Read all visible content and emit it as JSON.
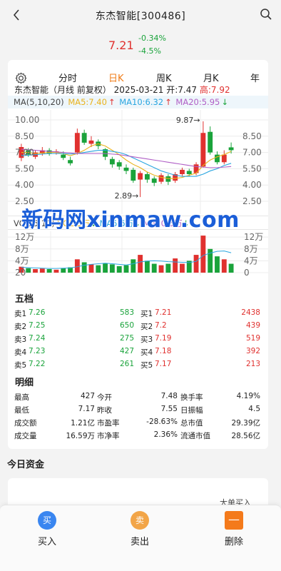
{
  "header": {
    "title": "东杰智能[300486]",
    "price": "7.21",
    "change_amount": "-0.34%",
    "change_percent": "-4.5%"
  },
  "tabs": [
    "分时",
    "日K",
    "周K",
    "月K",
    "年"
  ],
  "active_tab": "日K",
  "chart_info": {
    "name": "东杰智能",
    "mode": "（月线 前复权）",
    "date": "2025-03-21",
    "open": "开:7.47",
    "high": "高:7.92"
  },
  "ma_legend": {
    "label": "MA(5,10,20)",
    "ma5": "MA5:7.40",
    "ma10": "MA10:6.32",
    "ma20": "MA20:5.95",
    "ma5_arrow": "↑",
    "ma10_arrow": "↑",
    "ma20_arrow": "↓"
  },
  "chart_axis": {
    "left_ticks": [
      "10.00",
      "8.50",
      "7.00",
      "5.50",
      "4.00",
      "2.50"
    ],
    "right_ticks": [
      "8.50",
      "7.00",
      "5.50",
      "4.00",
      "2.50"
    ],
    "max_label": "9.87→",
    "min_label": "2.89→"
  },
  "vol_legend": {
    "label": "VOL(5,10)",
    "vol": "VOL:3万",
    "ma5": "MA5:5万",
    "ma10": "MA10:5万",
    "vol_arrow": "↓",
    "ma5_arrow": "↓",
    "ma10_arrow": "↓"
  },
  "vol_axis": {
    "left_ticks": [
      "12万",
      "8万",
      "4万",
      "20"
    ],
    "right_ticks": [
      "12万",
      "8万",
      "4万",
      "0"
    ],
    "date_label": "20"
  },
  "watermark": "新码网xinmaw.com",
  "order_book": {
    "title": "五档",
    "sell": [
      {
        "label": "卖1",
        "price": "7.26",
        "vol": "583"
      },
      {
        "label": "卖2",
        "price": "7.25",
        "vol": "650"
      },
      {
        "label": "卖3",
        "price": "7.24",
        "vol": "275"
      },
      {
        "label": "卖4",
        "price": "7.23",
        "vol": "427"
      },
      {
        "label": "卖5",
        "price": "7.22",
        "vol": "261"
      }
    ],
    "buy": [
      {
        "label": "买1",
        "price": "7.21",
        "vol": "2438"
      },
      {
        "label": "买2",
        "price": "7.2",
        "vol": "439"
      },
      {
        "label": "买3",
        "price": "7.19",
        "vol": "519"
      },
      {
        "label": "买4",
        "price": "7.18",
        "vol": "392"
      },
      {
        "label": "买5",
        "price": "7.17",
        "vol": "213"
      }
    ]
  },
  "detail": {
    "title": "明细",
    "rows": [
      [
        "最高",
        "427",
        "今开",
        "7.48",
        "换手率",
        "4.19%"
      ],
      [
        "最低",
        "7.17",
        "昨收",
        "7.55",
        "日振幅",
        "4.5"
      ],
      [
        "成交额",
        "1.21亿",
        "市盈率",
        "-28.63%",
        "总市值",
        "29.39亿"
      ],
      [
        "成交量",
        "16.59万",
        "市净率",
        "2.36%",
        "流通市值",
        "28.56亿"
      ]
    ]
  },
  "funds": {
    "title": "今日资金",
    "label": "大单买入"
  },
  "actions": {
    "buy": {
      "icon": "买",
      "label": "买入"
    },
    "sell": {
      "icon": "卖",
      "label": "卖出"
    },
    "delete": {
      "label": "删除"
    }
  },
  "colors": {
    "up": "#e0312f",
    "down": "#1aa33b",
    "ma5": "#e9b21b",
    "ma10": "#2aa6e0",
    "ma20": "#b05fc6",
    "accent": "#f07d1a"
  },
  "chart_data": {
    "type": "candlestick",
    "y_range": [
      2.5,
      10.0
    ],
    "candles": [
      {
        "o": 6.5,
        "c": 7.5,
        "h": 7.8,
        "l": 6.2
      },
      {
        "o": 7.2,
        "c": 6.8,
        "h": 7.4,
        "l": 6.6
      },
      {
        "o": 6.6,
        "c": 7.0,
        "h": 7.2,
        "l": 6.4
      },
      {
        "o": 6.9,
        "c": 7.2,
        "h": 7.5,
        "l": 6.7
      },
      {
        "o": 7.2,
        "c": 6.9,
        "h": 7.4,
        "l": 6.7
      },
      {
        "o": 7.0,
        "c": 7.1,
        "h": 7.3,
        "l": 6.8
      },
      {
        "o": 6.8,
        "c": 6.5,
        "h": 7.1,
        "l": 6.3
      },
      {
        "o": 6.3,
        "c": 6.0,
        "h": 6.6,
        "l": 5.8
      },
      {
        "o": 7.0,
        "c": 8.8,
        "h": 9.2,
        "l": 6.8
      },
      {
        "o": 8.8,
        "c": 7.9,
        "h": 9.1,
        "l": 7.7
      },
      {
        "o": 7.8,
        "c": 8.1,
        "h": 8.5,
        "l": 7.5
      },
      {
        "o": 8.0,
        "c": 7.6,
        "h": 8.2,
        "l": 7.3
      },
      {
        "o": 7.3,
        "c": 6.6,
        "h": 7.4,
        "l": 6.3
      },
      {
        "o": 6.4,
        "c": 5.9,
        "h": 6.6,
        "l": 5.6
      },
      {
        "o": 6.1,
        "c": 5.7,
        "h": 6.3,
        "l": 5.4
      },
      {
        "o": 5.6,
        "c": 5.3,
        "h": 5.9,
        "l": 5.0
      },
      {
        "o": 5.4,
        "c": 4.4,
        "h": 5.6,
        "l": 4.2
      },
      {
        "o": 4.5,
        "c": 5.1,
        "h": 5.3,
        "l": 2.89
      },
      {
        "o": 5.0,
        "c": 4.5,
        "h": 5.2,
        "l": 4.2
      },
      {
        "o": 4.6,
        "c": 4.2,
        "h": 4.8,
        "l": 3.9
      },
      {
        "o": 4.3,
        "c": 4.9,
        "h": 5.1,
        "l": 4.1
      },
      {
        "o": 4.8,
        "c": 4.3,
        "h": 5.0,
        "l": 4.0
      },
      {
        "o": 4.4,
        "c": 5.0,
        "h": 5.2,
        "l": 4.2
      },
      {
        "o": 5.0,
        "c": 5.4,
        "h": 5.6,
        "l": 4.8
      },
      {
        "o": 5.3,
        "c": 5.0,
        "h": 5.5,
        "l": 4.8
      },
      {
        "o": 5.1,
        "c": 5.9,
        "h": 6.1,
        "l": 4.9
      },
      {
        "o": 5.7,
        "c": 8.8,
        "h": 9.87,
        "l": 5.6
      },
      {
        "o": 8.9,
        "c": 7.0,
        "h": 9.4,
        "l": 6.8
      },
      {
        "o": 6.8,
        "c": 6.1,
        "h": 7.1,
        "l": 5.9
      },
      {
        "o": 6.1,
        "c": 6.8,
        "h": 7.2,
        "l": 5.9
      },
      {
        "o": 7.47,
        "c": 7.21,
        "h": 7.92,
        "l": 6.9
      }
    ],
    "ma5": [
      7.0,
      7.0,
      6.9,
      6.95,
      7.0,
      7.0,
      6.9,
      6.7,
      6.9,
      7.2,
      7.6,
      7.8,
      7.6,
      7.2,
      6.8,
      6.3,
      5.9,
      5.6,
      5.2,
      4.9,
      4.7,
      4.6,
      4.6,
      4.7,
      4.9,
      5.1,
      5.8,
      6.3,
      6.6,
      6.8,
      7.1
    ],
    "ma10": [
      6.7,
      6.75,
      6.8,
      6.85,
      6.9,
      6.9,
      6.9,
      6.85,
      6.9,
      7.0,
      7.1,
      7.2,
      7.2,
      7.1,
      7.0,
      6.8,
      6.5,
      6.2,
      5.9,
      5.6,
      5.3,
      5.1,
      4.9,
      4.8,
      4.8,
      4.8,
      5.0,
      5.3,
      5.5,
      5.8,
      6.0
    ],
    "ma20": [
      7.3,
      7.25,
      7.2,
      7.15,
      7.1,
      7.05,
      7.0,
      6.95,
      6.9,
      6.9,
      6.9,
      6.9,
      6.9,
      6.85,
      6.8,
      6.7,
      6.6,
      6.5,
      6.4,
      6.3,
      6.2,
      6.1,
      6.0,
      5.9,
      5.8,
      5.7,
      5.65,
      5.6,
      5.6,
      5.65,
      5.7
    ],
    "volume": [
      2,
      1.5,
      1.2,
      1.4,
      1.2,
      1.0,
      1.5,
      1.8,
      4.5,
      3.5,
      2.8,
      2.5,
      3.2,
      2.8,
      2.2,
      2.5,
      4.5,
      6.0,
      4.0,
      3.0,
      2.5,
      3.0,
      4.8,
      3.0,
      4.0,
      6.0,
      12.5,
      8.0,
      5.5,
      4.5,
      3.0
    ],
    "vol_ma5": [
      1.8,
      1.7,
      1.6,
      1.5,
      1.4,
      1.4,
      1.5,
      1.6,
      2.0,
      2.5,
      2.8,
      3.0,
      3.2,
      3.0,
      2.8,
      2.6,
      3.0,
      3.6,
      3.9,
      4.0,
      3.9,
      3.7,
      3.6,
      3.5,
      3.4,
      3.8,
      5.8,
      6.6,
      7.2,
      7.3,
      6.7
    ],
    "vol_max": 13
  }
}
